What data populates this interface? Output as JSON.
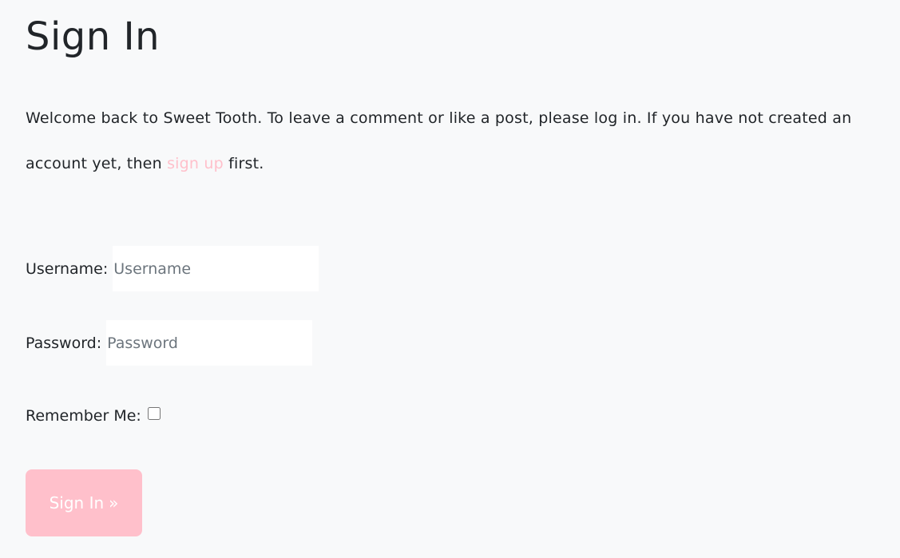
{
  "page": {
    "title": "Sign In"
  },
  "intro": {
    "text_before": "Welcome back to Sweet Tooth. To leave a comment or like a post, please log in. If you have not created an account yet, then ",
    "link_text": "sign up",
    "text_after": " first."
  },
  "form": {
    "username_label": "Username:",
    "username_placeholder": "Username",
    "username_value": "",
    "password_label": "Password:",
    "password_placeholder": "Password",
    "password_value": "",
    "remember_label": "Remember Me:",
    "remember_checked": false,
    "submit_label": "Sign In",
    "submit_icon": "»"
  },
  "colors": {
    "accent": "#ffc0cb",
    "background": "#f8f9fa",
    "text": "#212529"
  }
}
